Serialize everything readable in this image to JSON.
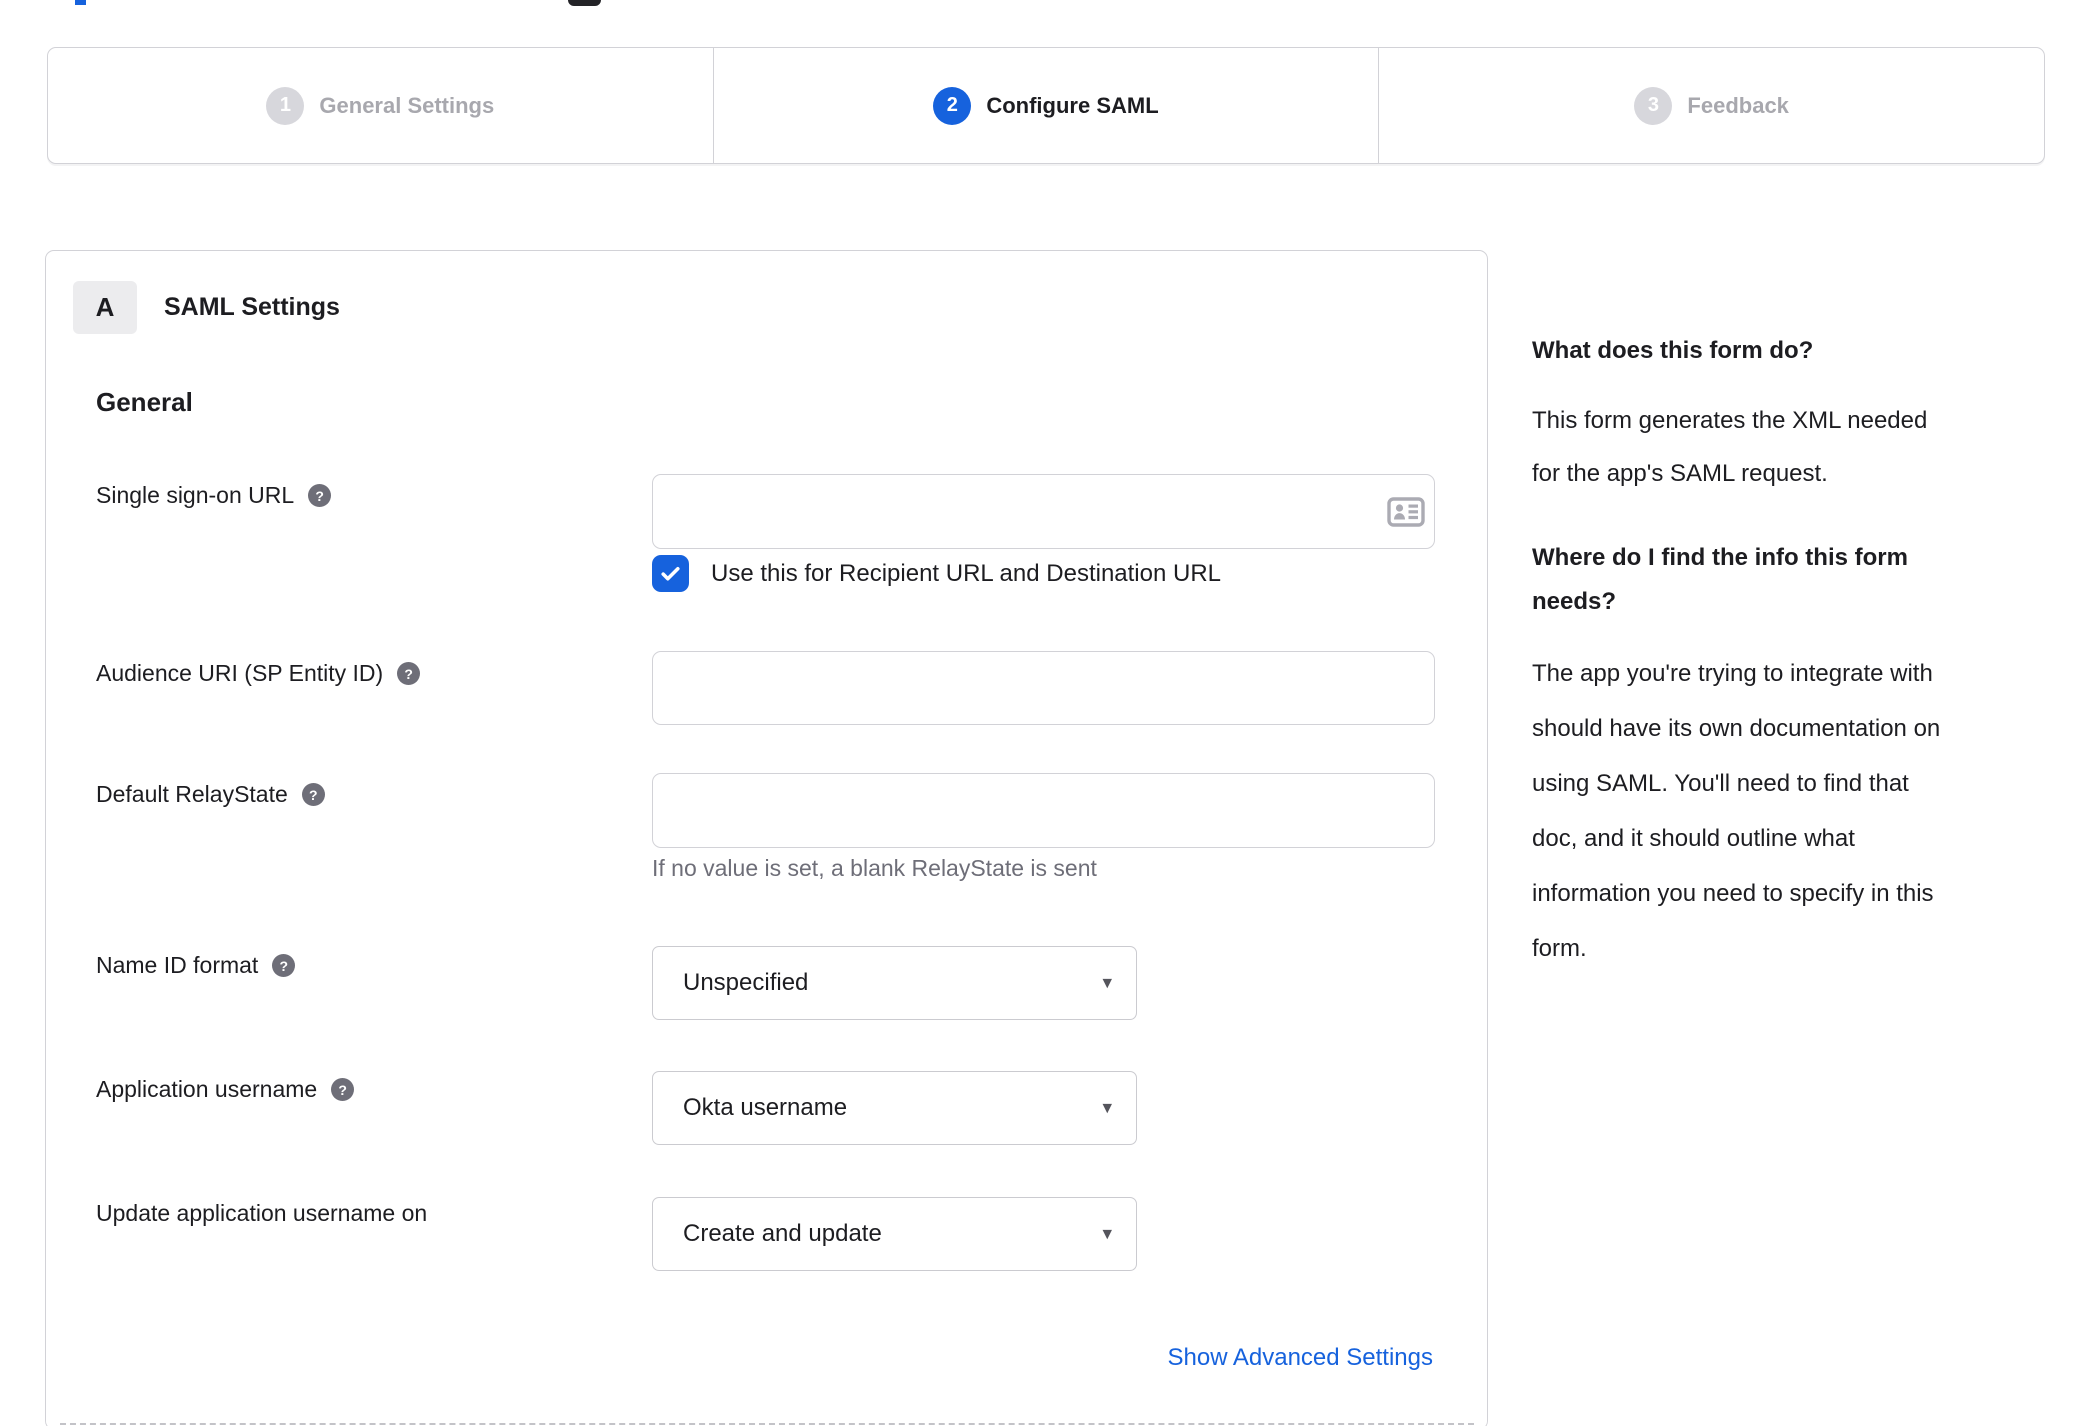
{
  "colors": {
    "accent_blue": "#1662dd",
    "inactive_gray": "#a8a8ae",
    "border_gray": "#d2d2d7",
    "text_dark": "#1d1d21",
    "help_icon_bg": "#6e6e78"
  },
  "icons": {
    "help_glyph": "?",
    "dropdown_arrow_glyph": "▾"
  },
  "stepper": {
    "steps": [
      {
        "number": "1",
        "label": "General Settings",
        "state": "inactive"
      },
      {
        "number": "2",
        "label": "Configure SAML",
        "state": "active"
      },
      {
        "number": "3",
        "label": "Feedback",
        "state": "inactive"
      }
    ]
  },
  "panel": {
    "badge": "A",
    "title": "SAML Settings",
    "section_heading": "General",
    "fields": [
      {
        "label": "Single sign-on URL",
        "has_help": true,
        "type": "text",
        "value": "",
        "checkbox": {
          "checked": true,
          "label": "Use this for Recipient URL and Destination URL"
        }
      },
      {
        "label": "Audience URI (SP Entity ID)",
        "has_help": true,
        "type": "text",
        "value": ""
      },
      {
        "label": "Default RelayState",
        "has_help": true,
        "type": "text",
        "value": "",
        "hint": "If no value is set, a blank RelayState is sent"
      },
      {
        "label": "Name ID format",
        "has_help": true,
        "type": "select",
        "value": "Unspecified"
      },
      {
        "label": "Application username",
        "has_help": true,
        "type": "select",
        "value": "Okta username"
      },
      {
        "label": "Update application username on",
        "has_help": false,
        "type": "select",
        "value": "Create and update"
      }
    ],
    "advanced_link": "Show Advanced Settings"
  },
  "sidebar": {
    "sections": [
      {
        "heading": "What does this form do?",
        "body_lines": [
          "This form generates the XML needed",
          "for the app's SAML request."
        ]
      },
      {
        "heading_lines": [
          "Where do I find the info this form",
          "needs?"
        ],
        "body_lines": [
          "The app you're trying to integrate with",
          "should have its own documentation on",
          "using SAML. You'll need to find that",
          "doc, and it should outline what",
          "information you need to specify in this",
          "form."
        ]
      }
    ]
  }
}
